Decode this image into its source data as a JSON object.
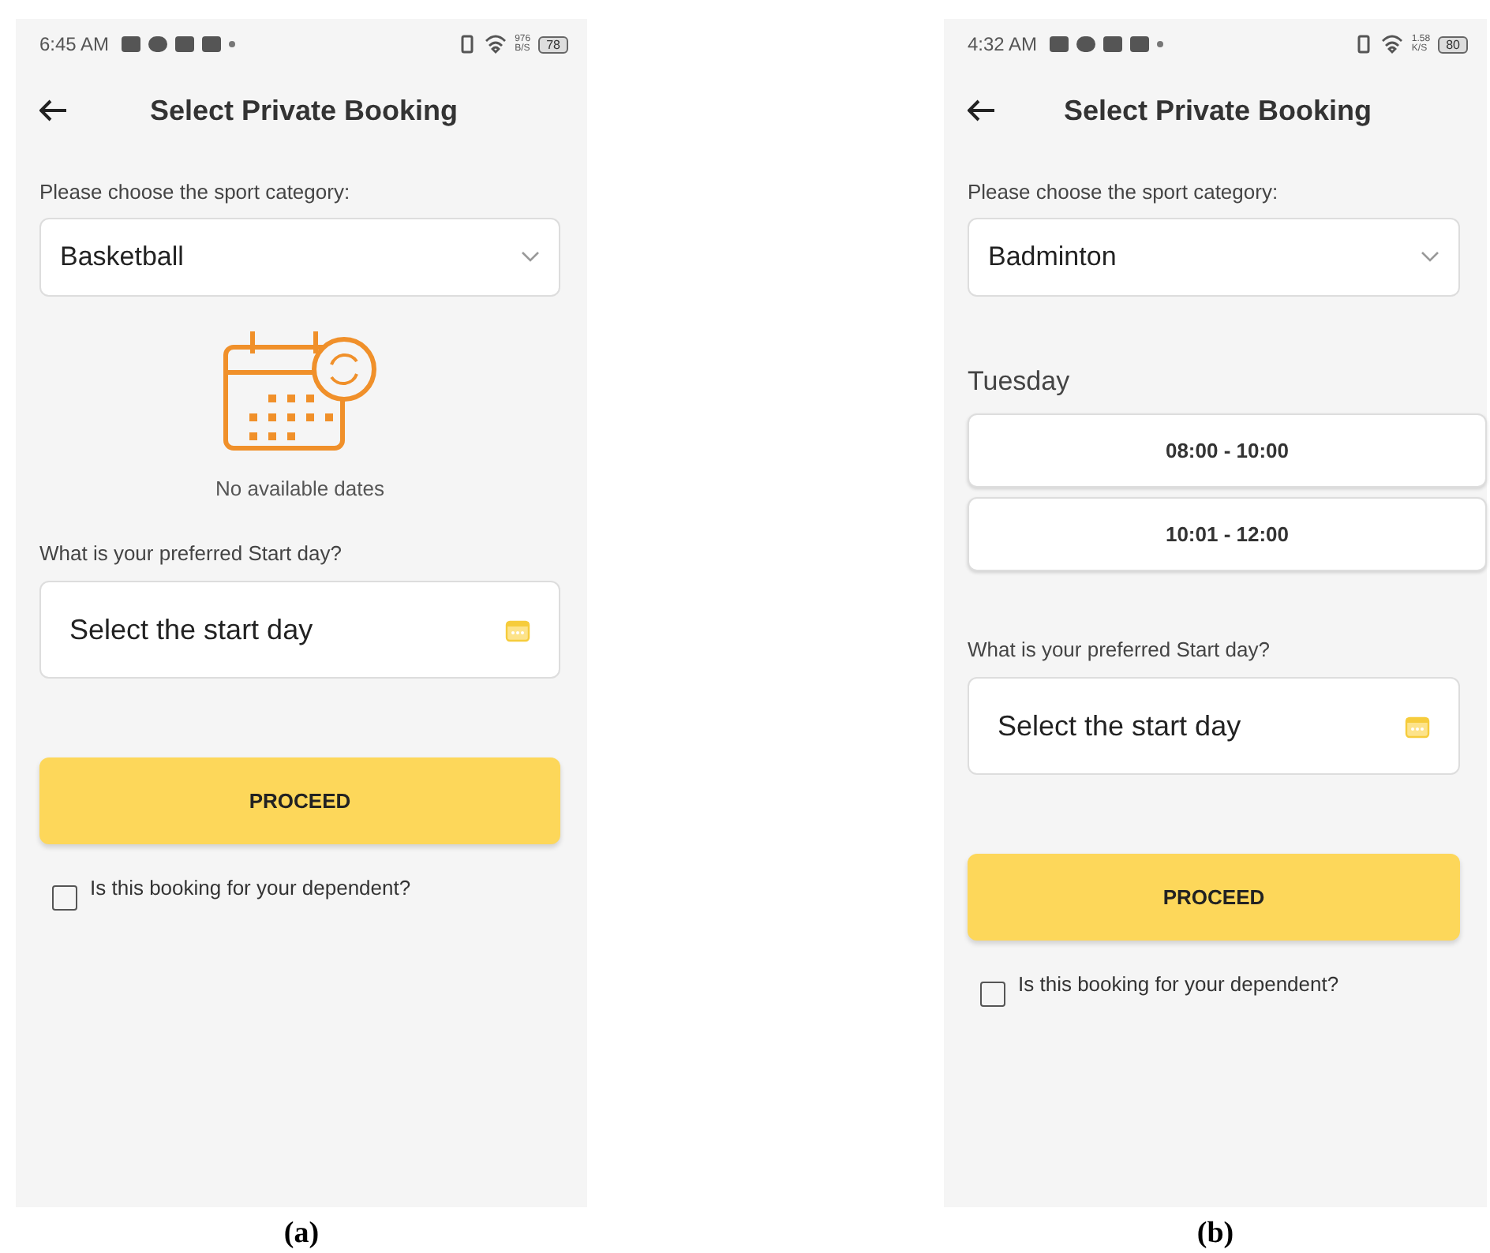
{
  "panels": [
    {
      "caption": "(a)",
      "status_bar": {
        "time": "6:45 AM",
        "speed_value": "976",
        "speed_unit": "B/S",
        "battery": "78"
      },
      "title": "Select Private Booking",
      "category_label": "Please choose the sport category:",
      "category_value": "Basketball",
      "availability": {
        "kind": "empty",
        "message": "No available dates"
      },
      "start_label": "What is your preferred Start day?",
      "start_placeholder": "Select the start day",
      "proceed": "PROCEED",
      "dependent": {
        "label": "Is this booking for your dependent?",
        "checked": false
      }
    },
    {
      "caption": "(b)",
      "status_bar": {
        "time": "4:32 AM",
        "speed_value": "1.58",
        "speed_unit": "K/S",
        "battery": "80"
      },
      "title": "Select Private Booking",
      "category_label": "Please choose the sport category:",
      "category_value": "Badminton",
      "availability": {
        "kind": "slots",
        "day": "Tuesday",
        "slots": [
          "08:00 - 10:00",
          "10:01 - 12:00"
        ]
      },
      "start_label": "What is your preferred Start day?",
      "start_placeholder": "Select the start day",
      "proceed": "PROCEED",
      "dependent": {
        "label": "Is this booking for your dependent?",
        "checked": false
      }
    }
  ]
}
